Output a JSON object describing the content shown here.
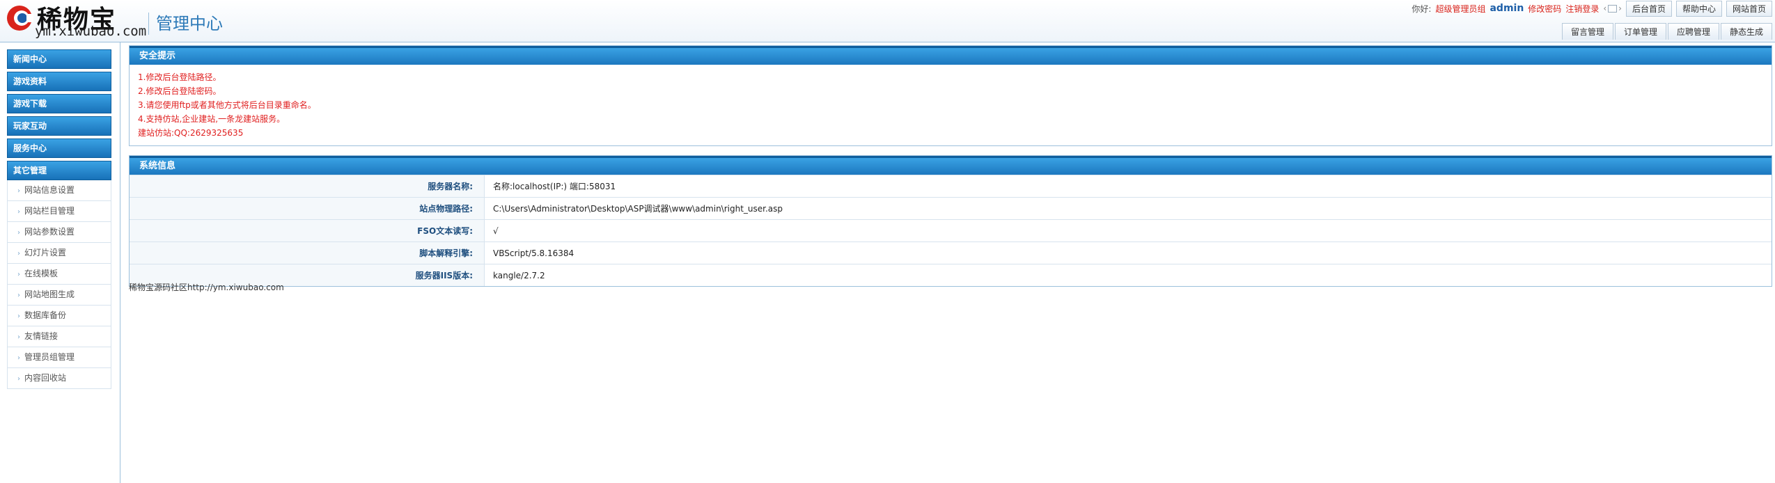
{
  "brand": {
    "name": "稀物宝",
    "url": "ym.xiwubao.com"
  },
  "header": {
    "title": "管理中心"
  },
  "topbar": {
    "greeting": "你好:",
    "role": "超级管理员组",
    "username": "admin",
    "change_password": "修改密码",
    "logout": "注销登录",
    "buttons": [
      "后台首页",
      "帮助中心",
      "网站首页"
    ]
  },
  "subnav": [
    "留言管理",
    "订单管理",
    "应聘管理",
    "静态生成"
  ],
  "sidebar": {
    "menus": [
      "新闻中心",
      "游戏资料",
      "游戏下载",
      "玩家互动",
      "服务中心",
      "其它管理"
    ],
    "items": [
      "网站信息设置",
      "网站栏目管理",
      "网站参数设置",
      "幻灯片设置",
      "在线模板",
      "网站地图生成",
      "数据库备份",
      "友情链接",
      "管理员组管理",
      "内容回收站"
    ]
  },
  "security": {
    "title": "安全提示",
    "tips": [
      "1.修改后台登陆路径。",
      "2.修改后台登陆密码。",
      "3.请您使用ftp或者其他方式将后台目录重命名。",
      "4.支持仿站,企业建站,一条龙建站服务。",
      "建站仿站:QQ:2629325635"
    ]
  },
  "sysinfo": {
    "title": "系统信息",
    "rows": [
      {
        "label": "服务器名称:",
        "value": "名称:localhost(IP:) 端口:58031"
      },
      {
        "label": "站点物理路径:",
        "value": "C:\\Users\\Administrator\\Desktop\\ASP调试器\\www\\admin\\right_user.asp"
      },
      {
        "label": "FSO文本读写:",
        "value": "√"
      },
      {
        "label": "脚本解释引擎:",
        "value": "VBScript/5.8.16384"
      },
      {
        "label": "服务器IIS版本:",
        "value": "kangle/2.7.2"
      }
    ]
  },
  "footer": {
    "text": "稀物宝源码社区http://ym.xiwubao.com"
  }
}
